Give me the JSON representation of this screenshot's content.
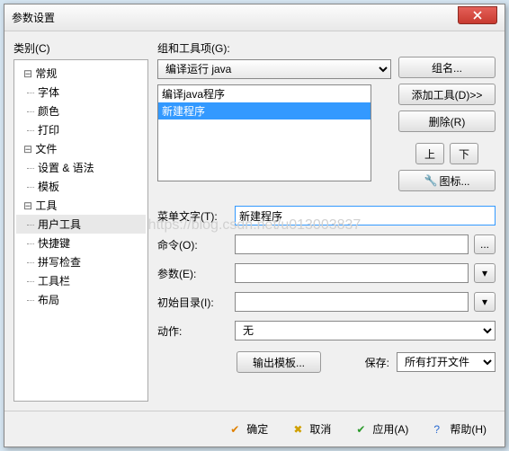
{
  "window": {
    "title": "参数设置"
  },
  "left": {
    "label": "类别(C)",
    "tree": {
      "general": "常规",
      "font": "字体",
      "color": "颜色",
      "print": "打印",
      "file": "文件",
      "settings_syntax": "设置 & 语法",
      "template": "模板",
      "tools": "工具",
      "user_tools": "用户工具",
      "shortcut": "快捷键",
      "spellcheck": "拼写检查",
      "toolbar": "工具栏",
      "layout": "布局"
    }
  },
  "right": {
    "group_label": "组和工具项(G):",
    "group_selected": "编译运行 java",
    "btn_group_name": "组名...",
    "btn_add_tool": "添加工具(D)>>",
    "btn_delete": "删除(R)",
    "btn_up": "上",
    "btn_down": "下",
    "btn_icon": "图标...",
    "list": {
      "item1": "编译java程序",
      "item2": "新建程序"
    },
    "menu_text_label": "菜单文字(T):",
    "menu_text_value": "新建程序",
    "command_label": "命令(O):",
    "command_value": "",
    "params_label": "参数(E):",
    "params_value": "",
    "initdir_label": "初始目录(I):",
    "initdir_value": "",
    "action_label": "动作:",
    "action_value": "无",
    "btn_output_template": "输出模板...",
    "save_label": "保存:",
    "save_value": "所有打开文件"
  },
  "footer": {
    "ok": "确定",
    "cancel": "取消",
    "apply": "应用(A)",
    "help": "帮助(H)"
  },
  "watermark": "https://blog.csdn.net/u013003837"
}
